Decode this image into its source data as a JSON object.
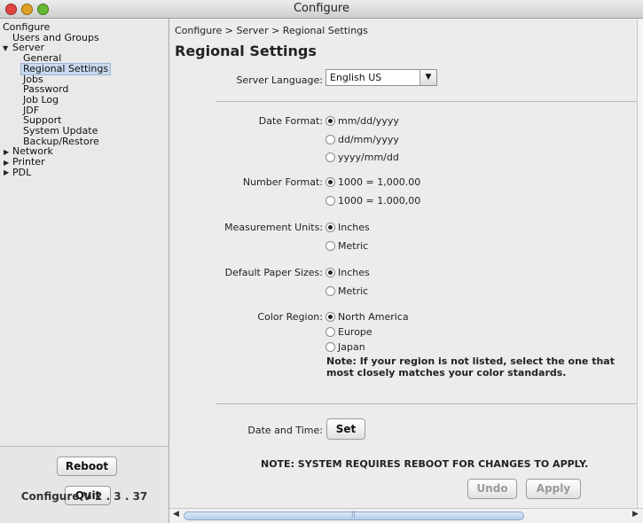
{
  "window": {
    "title": "Configure"
  },
  "tree": {
    "root": "Configure",
    "items": [
      {
        "label": "Users and Groups"
      },
      {
        "label": "Server"
      },
      {
        "label": "General"
      },
      {
        "label": "Regional Settings"
      },
      {
        "label": "Jobs"
      },
      {
        "label": "Password"
      },
      {
        "label": "Job Log"
      },
      {
        "label": "JDF"
      },
      {
        "label": "Support"
      },
      {
        "label": "System Update"
      },
      {
        "label": "Backup/Restore"
      },
      {
        "label": "Network"
      },
      {
        "label": "Printer"
      },
      {
        "label": "PDL"
      }
    ],
    "selected": "Regional Settings"
  },
  "left_buttons": {
    "reboot": "Reboot",
    "quit": "Quit"
  },
  "version": "Configure V 2 . 3 . 37",
  "main": {
    "breadcrumb": "Configure > Server > Regional Settings",
    "title": "Regional Settings",
    "server_language": {
      "label": "Server Language:",
      "value": "English US"
    },
    "date_format": {
      "label": "Date Format:",
      "options": [
        "mm/dd/yyyy",
        "dd/mm/yyyy",
        "yyyy/mm/dd"
      ],
      "selected": 0
    },
    "number_format": {
      "label": "Number Format:",
      "options": [
        "1000 = 1,000.00",
        "1000 = 1.000,00"
      ],
      "selected": 0
    },
    "measurement_units": {
      "label": "Measurement Units:",
      "options": [
        "Inches",
        "Metric"
      ],
      "selected": 0
    },
    "paper_sizes": {
      "label": "Default Paper Sizes:",
      "options": [
        "Inches",
        "Metric"
      ],
      "selected": 0
    },
    "color_region": {
      "label": "Color Region:",
      "options": [
        "North America",
        "Europe",
        "Japan"
      ],
      "selected": 0
    },
    "color_note": "Note: If your region is not listed, select the one that most closely matches your color standards.",
    "date_time": {
      "label": "Date and Time:",
      "button": "Set"
    },
    "reboot_note": "NOTE: SYSTEM REQUIRES REBOOT FOR CHANGES TO APPLY.",
    "undo": "Undo",
    "apply": "Apply"
  },
  "scrollbar": {
    "h_thumb_grip": "||"
  }
}
